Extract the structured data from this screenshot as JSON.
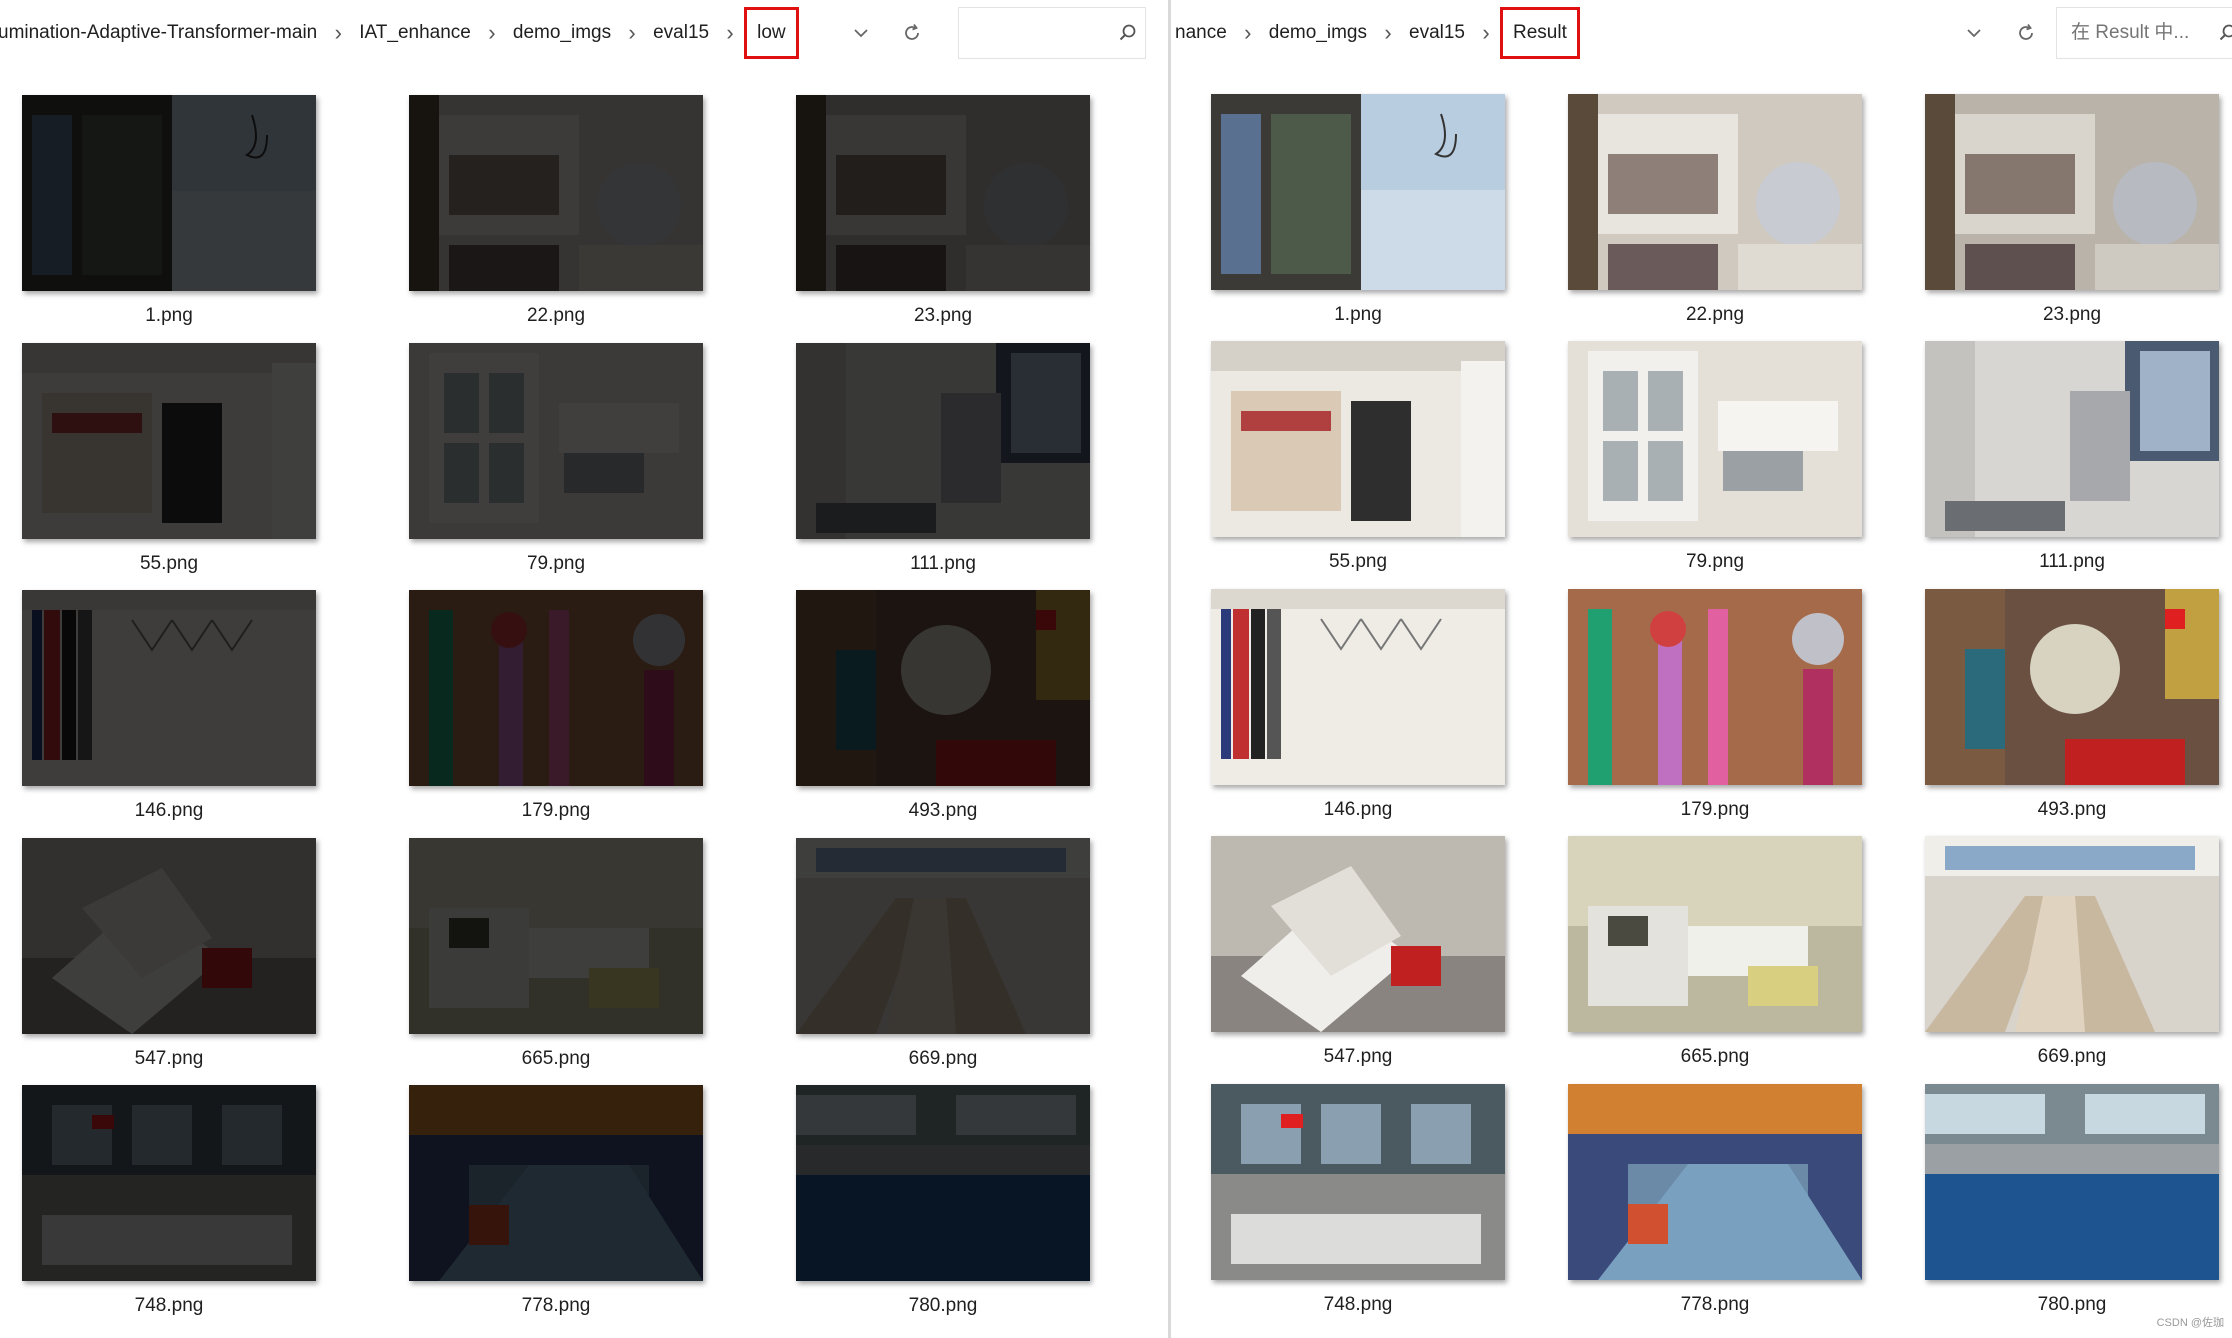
{
  "left_pane": {
    "breadcrumbs": [
      "umination-Adaptive-Transformer-main",
      "IAT_enhance",
      "demo_imgs",
      "eval15",
      "low"
    ],
    "highlighted_crumb": "low",
    "search_placeholder": "",
    "files": [
      "1.png",
      "22.png",
      "23.png",
      "55.png",
      "79.png",
      "111.png",
      "146.png",
      "179.png",
      "493.png",
      "547.png",
      "665.png",
      "669.png",
      "748.png",
      "778.png",
      "780.png"
    ],
    "dimmed": true
  },
  "right_pane": {
    "breadcrumbs": [
      "nance",
      "demo_imgs",
      "eval15",
      "Result"
    ],
    "highlighted_crumb": "Result",
    "search_placeholder": "在 Result 中...",
    "files": [
      "1.png",
      "22.png",
      "23.png",
      "55.png",
      "79.png",
      "111.png",
      "146.png",
      "179.png",
      "493.png",
      "547.png",
      "665.png",
      "669.png",
      "748.png",
      "778.png",
      "780.png"
    ],
    "dimmed": false
  },
  "icons": {
    "separator": "chevron-right-icon",
    "dropdown": "chevron-down-icon",
    "refresh": "refresh-icon",
    "search": "search-icon"
  },
  "colors": {
    "highlight_box": "#e01010",
    "divider": "#d9d9d9"
  },
  "watermark": "CSDN @佐珈"
}
